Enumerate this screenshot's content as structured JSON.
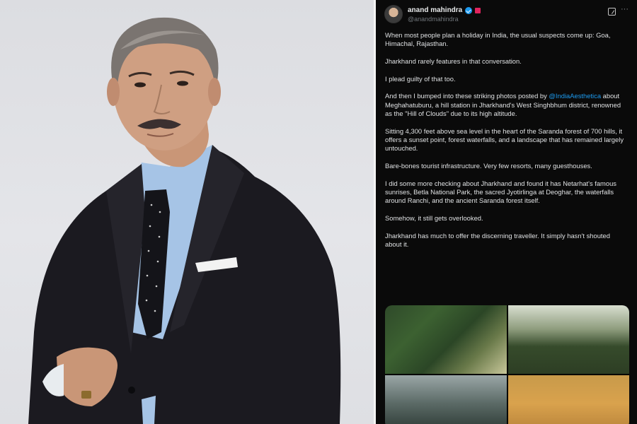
{
  "tweet": {
    "author": {
      "display_name": "anand mahindra",
      "handle": "@anandmahindra",
      "verified": true
    },
    "paragraphs": {
      "p1": "When most people plan a holiday in India, the usual suspects come up: Goa, Himachal, Rajasthan.",
      "p2": "Jharkhand rarely features in that conversation.",
      "p3": "I plead guilty of that too.",
      "p4_before": "And then I bumped into these striking photos posted by ",
      "p4_mention": "@IndiaAesthetica",
      "p4_after": " about Meghahatuburu, a hill station in Jharkhand's West Singhbhum district, renowned as the \"Hill of Clouds\" due to its high altitude.",
      "p5": "Sitting 4,300 feet above sea level in the heart of the Saranda forest of 700 hills, it offers a sunset point, forest waterfalls, and a landscape that has remained largely untouched.",
      "p6": "Bare-bones tourist infrastructure.  Very few resorts, many guesthouses.",
      "p7": "I did some more checking about Jharkhand and found it has Netarhat's famous sunrises, Betla National Park, the sacred Jyotirlinga at Deoghar, the waterfalls around Ranchi, and the ancient Saranda forest itself.",
      "p8": "Somehow, it still gets overlooked.",
      "p9": "Jharkhand has much to offer the discerning traveller. It simply hasn't shouted about it."
    },
    "icons": {
      "more": "more-options-icon",
      "grok": "grok-icon",
      "verified": "verified-badge-icon"
    },
    "more_glyph": "···",
    "colors": {
      "link": "#1d9bf0",
      "background": "#0a0a0a",
      "text": "#e7e9ea",
      "secondary": "#71767b"
    }
  }
}
